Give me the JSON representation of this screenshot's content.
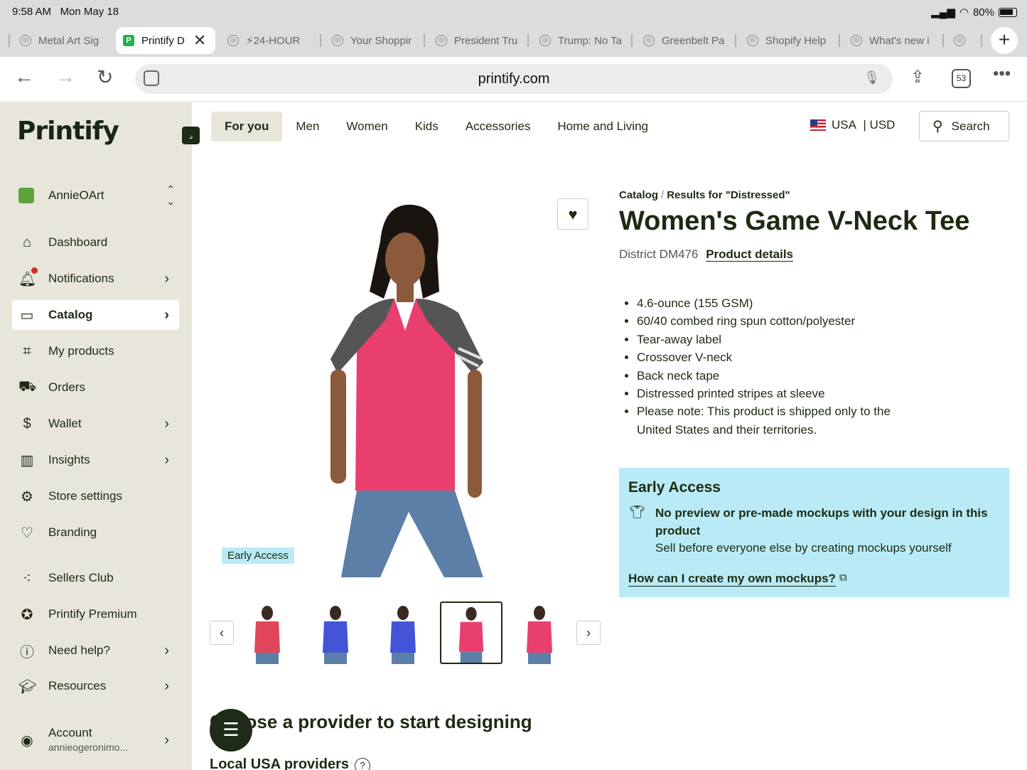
{
  "status_bar": {
    "time": "9:58 AM",
    "date": "Mon May 18",
    "battery": "80%"
  },
  "tabs": [
    {
      "label": "Metal Art Sig"
    },
    {
      "label": "Printify D",
      "active": true
    },
    {
      "label": "⚡24-HOUR"
    },
    {
      "label": "Your Shoppir"
    },
    {
      "label": "President Tru"
    },
    {
      "label": "Trump: No Ta"
    },
    {
      "label": "Greenbelt Pa"
    },
    {
      "label": "Shopify Help"
    },
    {
      "label": "What's new i"
    }
  ],
  "address_bar": {
    "url": "printify.com",
    "tab_count": "53"
  },
  "sidebar": {
    "logo": "Printify",
    "store_name": "AnnieOArt",
    "items": [
      {
        "label": "Dashboard"
      },
      {
        "label": "Notifications"
      },
      {
        "label": "Catalog"
      },
      {
        "label": "My products"
      },
      {
        "label": "Orders"
      },
      {
        "label": "Wallet"
      },
      {
        "label": "Insights"
      },
      {
        "label": "Store settings"
      },
      {
        "label": "Branding"
      },
      {
        "label": "Sellers Club"
      },
      {
        "label": "Printify Premium"
      },
      {
        "label": "Need help?"
      },
      {
        "label": "Resources"
      }
    ],
    "account": {
      "label": "Account",
      "email": "annieogeronimo..."
    }
  },
  "top_nav": {
    "categories": [
      "For you",
      "Men",
      "Women",
      "Kids",
      "Accessories",
      "Home and Living"
    ],
    "region": "USA",
    "currency": "| USD",
    "search_label": "Search"
  },
  "product": {
    "breadcrumb": [
      "Catalog",
      "Results for \"Distressed\""
    ],
    "title": "Women's Game V-Neck Tee",
    "sku": "District DM476",
    "details_link": "Product details",
    "early_access_badge": "Early Access",
    "features": [
      "4.6-ounce (155 GSM)",
      "60/40 combed ring spun cotton/polyester",
      "Tear-away label",
      "Crossover V-neck",
      "Back neck tape",
      "Distressed printed stripes at sleeve",
      "Please note: This product is shipped only to the United States and their territories."
    ]
  },
  "early_access_box": {
    "heading": "Early Access",
    "notice": "No preview or pre-made mockups with your design in this product",
    "sub": "Sell before everyone else by creating mockups yourself",
    "link": "How can I create my own mockups?"
  },
  "providers": {
    "heading": "Choose a provider to start designing",
    "local": "Local USA providers"
  },
  "colors": {
    "brand_dark": "#1d2b17",
    "sidebar_bg": "#e8e6da",
    "early_access_bg": "#b9ebf7",
    "shirt_pink": "#e83f6f",
    "shirt_blue": "#4454d6"
  }
}
